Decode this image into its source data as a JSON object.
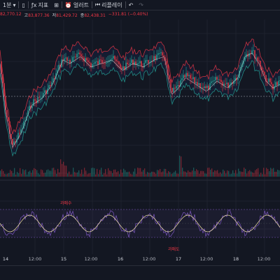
{
  "toolbar": {
    "interval": "1분",
    "indicators": "지표",
    "alert": "얼러트",
    "replay": "리플레이"
  },
  "ohlc": {
    "open": "82,770.12",
    "high_label": "고",
    "high": "83,877.36",
    "low_label": "저",
    "low": "81,429.72",
    "close_label": "종",
    "close": "82,438.31",
    "change": "−331.81 (−0.40%)"
  },
  "annotations": {
    "overbought": "과매수",
    "oversold": "과매도"
  },
  "time_axis": [
    {
      "label": "14",
      "day": true
    },
    {
      "label": "12:00",
      "day": false
    },
    {
      "label": "15",
      "day": true
    },
    {
      "label": "12:00",
      "day": false
    },
    {
      "label": "16",
      "day": true
    },
    {
      "label": "12:00",
      "day": false
    },
    {
      "label": "17",
      "day": true
    },
    {
      "label": "12:00",
      "day": false
    },
    {
      "label": "18",
      "day": true
    },
    {
      "label": "12:00",
      "day": false
    }
  ],
  "colors": {
    "background": "#131722",
    "up": "#26a69a",
    "down": "#f23645",
    "band": "#2962ff",
    "rsi": "#7e57c2",
    "text": "#d1d4dc"
  }
}
